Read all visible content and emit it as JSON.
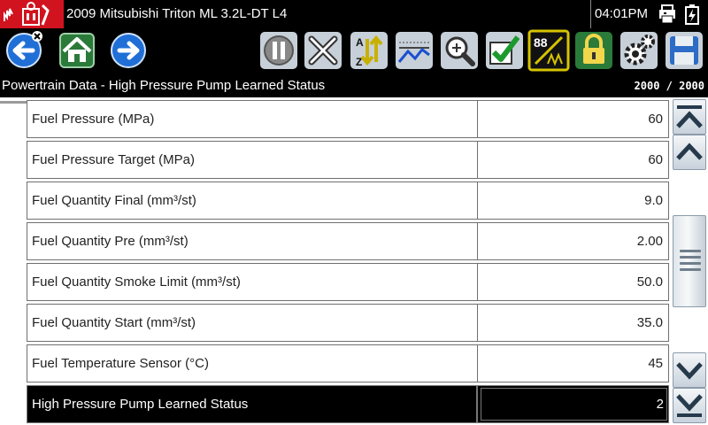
{
  "title_bar": {
    "vehicle": "2009 Mitsubishi Triton ML 3.2L-DT L4",
    "time": "04:01PM",
    "logo_icon": "snapon-logo-icon",
    "status_icons": [
      "printer-icon",
      "battery-icon"
    ]
  },
  "toolbar": {
    "buttons": [
      {
        "name": "back-button",
        "icon": "back-arrow-icon"
      },
      {
        "name": "home-button",
        "icon": "home-icon"
      },
      {
        "name": "forward-button",
        "icon": "forward-arrow-icon"
      },
      {
        "name": "pause-button",
        "icon": "pause-icon"
      },
      {
        "name": "clear-button",
        "icon": "x-icon"
      },
      {
        "name": "sort-button",
        "icon": "sort-icon"
      },
      {
        "name": "graph-button",
        "icon": "graph-icon"
      },
      {
        "name": "zoom-button",
        "icon": "zoom-icon"
      },
      {
        "name": "select-button",
        "icon": "checkmark-icon"
      },
      {
        "name": "pid-view-button",
        "icon": "pid-view-icon",
        "label": "88"
      },
      {
        "name": "lock-button",
        "icon": "lock-icon"
      },
      {
        "name": "settings-button",
        "icon": "gear-icon"
      },
      {
        "name": "save-button",
        "icon": "save-icon"
      }
    ]
  },
  "subheader": {
    "title": "Powertrain Data - High Pressure Pump Learned Status",
    "frame_counter": "2000 / 2000"
  },
  "rows": [
    {
      "label": "Fuel Pressure (MPa)",
      "value": "60"
    },
    {
      "label": "Fuel Pressure Target (MPa)",
      "value": "60"
    },
    {
      "label": "Fuel Quantity Final (mm³/st)",
      "value": "9.0"
    },
    {
      "label": "Fuel Quantity Pre (mm³/st)",
      "value": "2.00"
    },
    {
      "label": "Fuel Quantity Smoke Limit (mm³/st)",
      "value": "50.0"
    },
    {
      "label": "Fuel Quantity Start (mm³/st)",
      "value": "35.0"
    },
    {
      "label": "Fuel Temperature Sensor (°C)",
      "value": "45"
    },
    {
      "label": "High Pressure Pump Learned Status",
      "value": "2",
      "selected": true
    }
  ],
  "scrollbar": {
    "icons": [
      "scroll-top-icon",
      "scroll-up-icon",
      "scroll-down-icon",
      "scroll-bottom-icon"
    ]
  },
  "colors": {
    "brand_red": "#d0131f",
    "toolbar_bg": "#000000",
    "selected_row_bg": "#000000",
    "button_blue": "#1f6fd6",
    "pid_button_yellow": "#d6c400"
  }
}
